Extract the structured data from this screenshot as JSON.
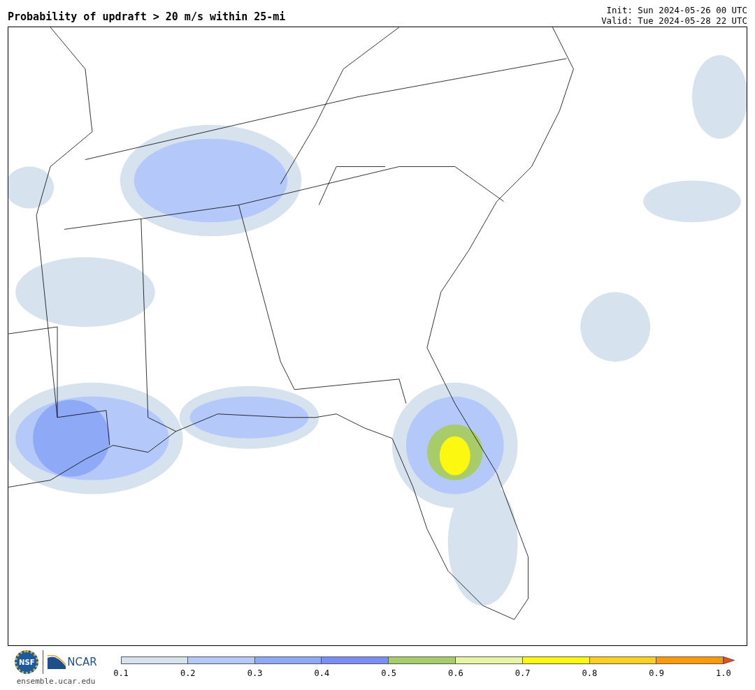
{
  "header": {
    "title": "Probability of updraft > 20 m/s within 25-mi",
    "init": "Init: Sun 2024-05-26 00 UTC",
    "valid": "Valid: Tue 2024-05-28 22 UTC"
  },
  "logos": {
    "nsf": "NSF",
    "ncar": "NCAR",
    "url": "ensemble.ucar.edu"
  },
  "legend": {
    "bins": [
      {
        "kind": "band",
        "color": "#d6e2ee"
      },
      {
        "kind": "band",
        "color": "#b4c8fa"
      },
      {
        "kind": "band",
        "color": "#8ea9f5"
      },
      {
        "kind": "band",
        "color": "#7b8ef5"
      },
      {
        "kind": "band",
        "color": "#a8cc6a"
      },
      {
        "kind": "band",
        "color": "#e6f5a6"
      },
      {
        "kind": "band",
        "color": "#fcf80f"
      },
      {
        "kind": "band",
        "color": "#fdd020"
      },
      {
        "kind": "band",
        "color": "#fd9a0a"
      },
      {
        "kind": "arrow",
        "color": "#f54a0a"
      }
    ],
    "ticks": [
      "0.1",
      "0.2",
      "0.3",
      "0.4",
      "0.5",
      "0.6",
      "0.7",
      "0.8",
      "0.9",
      "1.0"
    ]
  }
}
